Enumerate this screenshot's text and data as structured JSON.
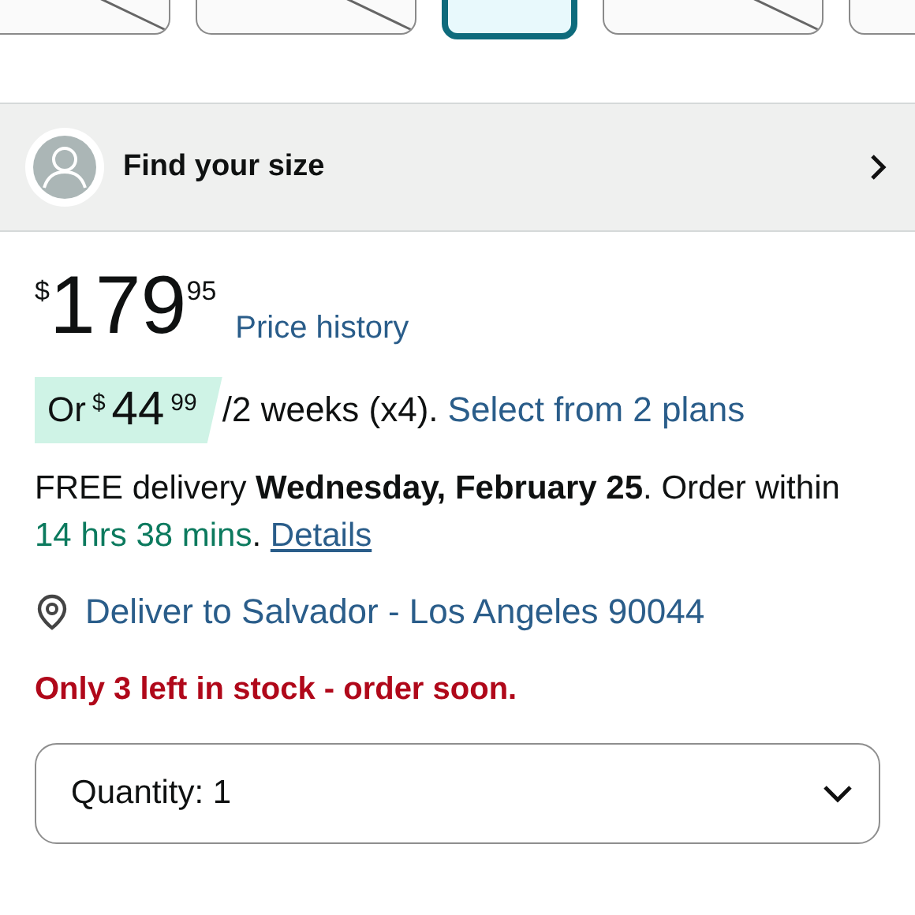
{
  "thumbnails": [
    {
      "selected": false
    },
    {
      "selected": false
    },
    {
      "selected": true
    },
    {
      "selected": false
    },
    {
      "selected": false
    }
  ],
  "size_finder": {
    "label": "Find your size"
  },
  "price": {
    "currency": "$",
    "whole": "179",
    "fraction": "95",
    "history_link": "Price history"
  },
  "installments": {
    "prefix": "Or",
    "currency": "$",
    "whole": "44",
    "fraction": "99",
    "period": "/2 weeks (x4).",
    "link": "Select from 2 plans"
  },
  "delivery": {
    "text": "FREE delivery **Wednesday, February 25**. Order within",
    "countdown": "14 hrs 38 mins",
    "suffix": ".",
    "link": "Details"
  },
  "location": {
    "link": "Deliver to Salvador - Los Angeles 90044"
  },
  "stock": {
    "text": "Only 3 left in stock - order soon."
  },
  "quantity": {
    "label": "Quantity: 1"
  }
}
